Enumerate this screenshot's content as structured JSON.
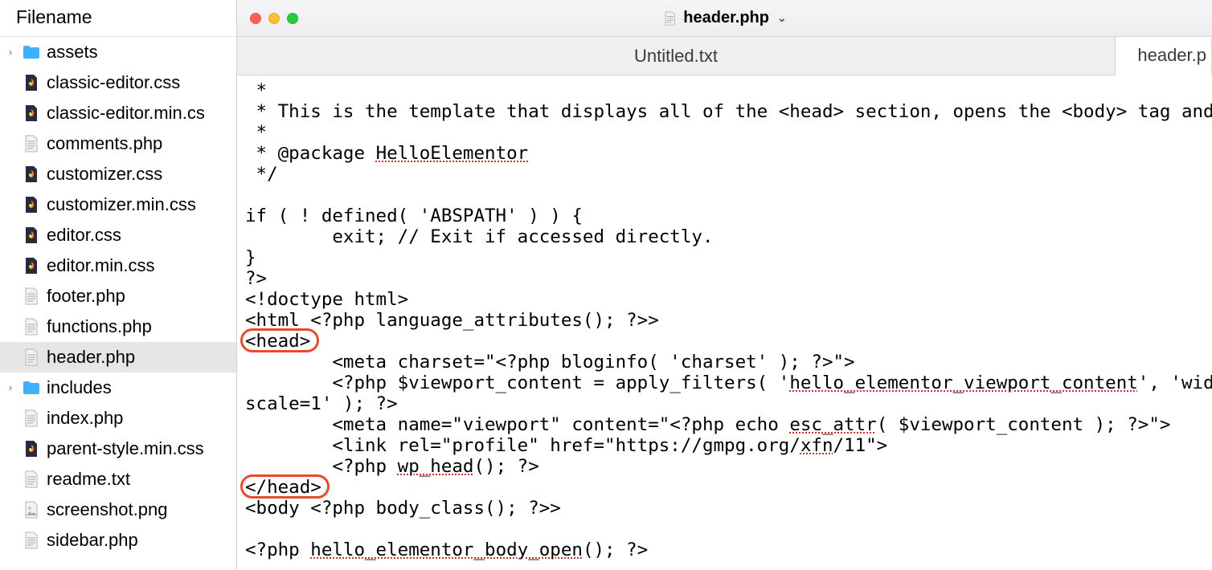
{
  "sidebar": {
    "header": "Filename",
    "items": [
      {
        "name": "assets",
        "type": "folder",
        "expandable": true
      },
      {
        "name": "classic-editor.css",
        "type": "css"
      },
      {
        "name": "classic-editor.min.css",
        "type": "css",
        "truncated": "classic-editor.min.cs"
      },
      {
        "name": "comments.php",
        "type": "txt"
      },
      {
        "name": "customizer.css",
        "type": "css"
      },
      {
        "name": "customizer.min.css",
        "type": "css"
      },
      {
        "name": "editor.css",
        "type": "css"
      },
      {
        "name": "editor.min.css",
        "type": "css"
      },
      {
        "name": "footer.php",
        "type": "txt"
      },
      {
        "name": "functions.php",
        "type": "txt"
      },
      {
        "name": "header.php",
        "type": "txt",
        "selected": true
      },
      {
        "name": "includes",
        "type": "folder",
        "expandable": true
      },
      {
        "name": "index.php",
        "type": "txt"
      },
      {
        "name": "parent-style.min.css",
        "type": "css"
      },
      {
        "name": "readme.txt",
        "type": "txt"
      },
      {
        "name": "screenshot.png",
        "type": "png"
      },
      {
        "name": "sidebar.php",
        "type": "txt"
      }
    ]
  },
  "window": {
    "title": "header.php",
    "tabs": [
      {
        "label": "Untitled.txt",
        "active": false
      },
      {
        "label": "header.p",
        "active": true,
        "truncated": true
      }
    ]
  },
  "code": {
    "lines": [
      " *",
      " * This is the template that displays all of the <head> section, opens the <body> tag and a",
      " *",
      " * @package HelloElementor",
      " */",
      "",
      "if ( ! defined( 'ABSPATH' ) ) {",
      "        exit; // Exit if accessed directly.",
      "}",
      "?>",
      "<!doctype html>",
      "<html <?php language_attributes(); ?>>",
      "<head>",
      "        <meta charset=\"<?php bloginfo( 'charset' ); ?>\">",
      "        <?php $viewport_content = apply_filters( 'hello_elementor_viewport_content', 'width",
      "scale=1' ); ?>",
      "        <meta name=\"viewport\" content=\"<?php echo esc_attr( $viewport_content ); ?>\">",
      "        <link rel=\"profile\" href=\"https://gmpg.org/xfn/11\">",
      "        <?php wp_head(); ?>",
      "</head>",
      "<body <?php body_class(); ?>>",
      "",
      "<?php hello_elementor_body_open(); ?>"
    ],
    "spellcheck_tokens": [
      "HelloElementor",
      "hello_elementor_viewport_content",
      "esc_attr",
      "xfn",
      "wp_head",
      "hello_elementor_body_open"
    ],
    "annotations": [
      {
        "target": "<head>",
        "line_index": 12
      },
      {
        "target": "</head>",
        "line_index": 19
      }
    ]
  }
}
